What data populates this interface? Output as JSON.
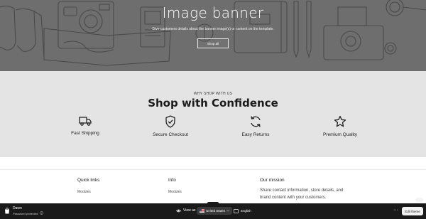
{
  "banner": {
    "title": "Image banner",
    "subtitle": "Give customers details about the banner image(s) or content on the template.",
    "button_label": "Shop all"
  },
  "confidence": {
    "eyebrow": "WHY SHOP WITH US",
    "title": "Shop with Confidence",
    "features": [
      {
        "label": "Fast Shipping",
        "icon": "truck-icon"
      },
      {
        "label": "Secure Checkout",
        "icon": "shield-check-icon"
      },
      {
        "label": "Easy Returns",
        "icon": "refresh-icon"
      },
      {
        "label": "Premium Quality",
        "icon": "star-icon"
      }
    ]
  },
  "footer": {
    "quick_links": {
      "heading": "Quick links",
      "links": [
        "Modules"
      ]
    },
    "info": {
      "heading": "Info",
      "links": [
        "Modules"
      ]
    },
    "mission": {
      "heading": "Our mission",
      "text": "Share contact information, store details, and brand content with your customers."
    }
  },
  "admin_bar": {
    "store_name": "Dawn",
    "status": "Password protected",
    "view_as_label": "View as",
    "country": "United States",
    "language": "English",
    "edit_button": "Edit theme"
  },
  "colors": {
    "banner_bg": "#6e6e6e",
    "section_bg": "#e4e4e4",
    "admin_bar_bg": "#1a1a1a"
  }
}
